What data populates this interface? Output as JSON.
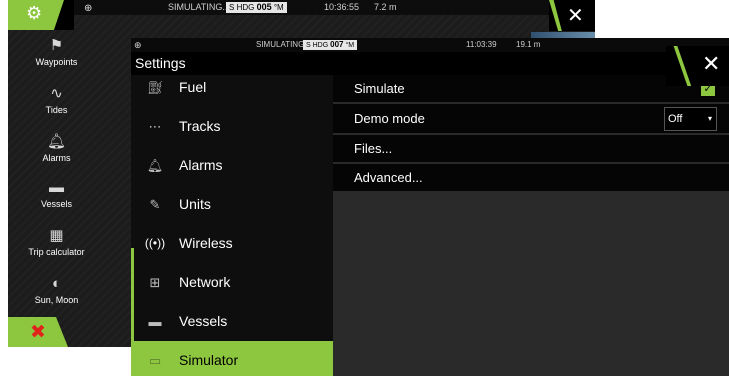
{
  "background_screen": {
    "status": {
      "simulating": "SIMULATING...",
      "hdg_prefix": "S",
      "hdg_label": "HDG",
      "hdg_value": "005",
      "hdg_unit": "°M",
      "time": "10:36:55",
      "distance": "7.2 m"
    },
    "sidebar_items": [
      {
        "label": "Waypoints",
        "icon": "flag-icon"
      },
      {
        "label": "Tides",
        "icon": "wave-icon"
      },
      {
        "label": "Alarms",
        "icon": "bell-icon"
      },
      {
        "label": "Vessels",
        "icon": "vessel-icon"
      },
      {
        "label": "Trip calculator",
        "icon": "calculator-icon"
      },
      {
        "label": "Sun, Moon",
        "icon": "sun-moon-icon"
      }
    ]
  },
  "settings": {
    "status": {
      "simulating": "SIMULATING...",
      "hdg_prefix": "S",
      "hdg_label": "HDG",
      "hdg_value": "007",
      "hdg_unit": "°M",
      "time": "11:03:39",
      "distance": "19.1 m"
    },
    "title": "Settings",
    "menu": [
      {
        "label": "Fuel",
        "icon": "fuel-pump-icon",
        "selected": false
      },
      {
        "label": "Tracks",
        "icon": "tracks-icon",
        "selected": false
      },
      {
        "label": "Alarms",
        "icon": "bell-icon",
        "selected": false
      },
      {
        "label": "Units",
        "icon": "ruler-icon",
        "selected": false
      },
      {
        "label": "Wireless",
        "icon": "wireless-icon",
        "selected": false
      },
      {
        "label": "Network",
        "icon": "network-icon",
        "selected": false
      },
      {
        "label": "Vessels",
        "icon": "vessel-icon",
        "selected": false
      },
      {
        "label": "Simulator",
        "icon": "simulator-icon",
        "selected": true
      }
    ],
    "options": {
      "simulate": {
        "label": "Simulate",
        "checked": true
      },
      "demo_mode": {
        "label": "Demo mode",
        "value": "Off"
      },
      "files": {
        "label": "Files..."
      },
      "advanced": {
        "label": "Advanced..."
      }
    }
  },
  "colors": {
    "accent": "#8dc63f",
    "danger": "#e0231b",
    "menu_bg": "#0e0e0e",
    "content_bg": "#2a2a2a"
  }
}
